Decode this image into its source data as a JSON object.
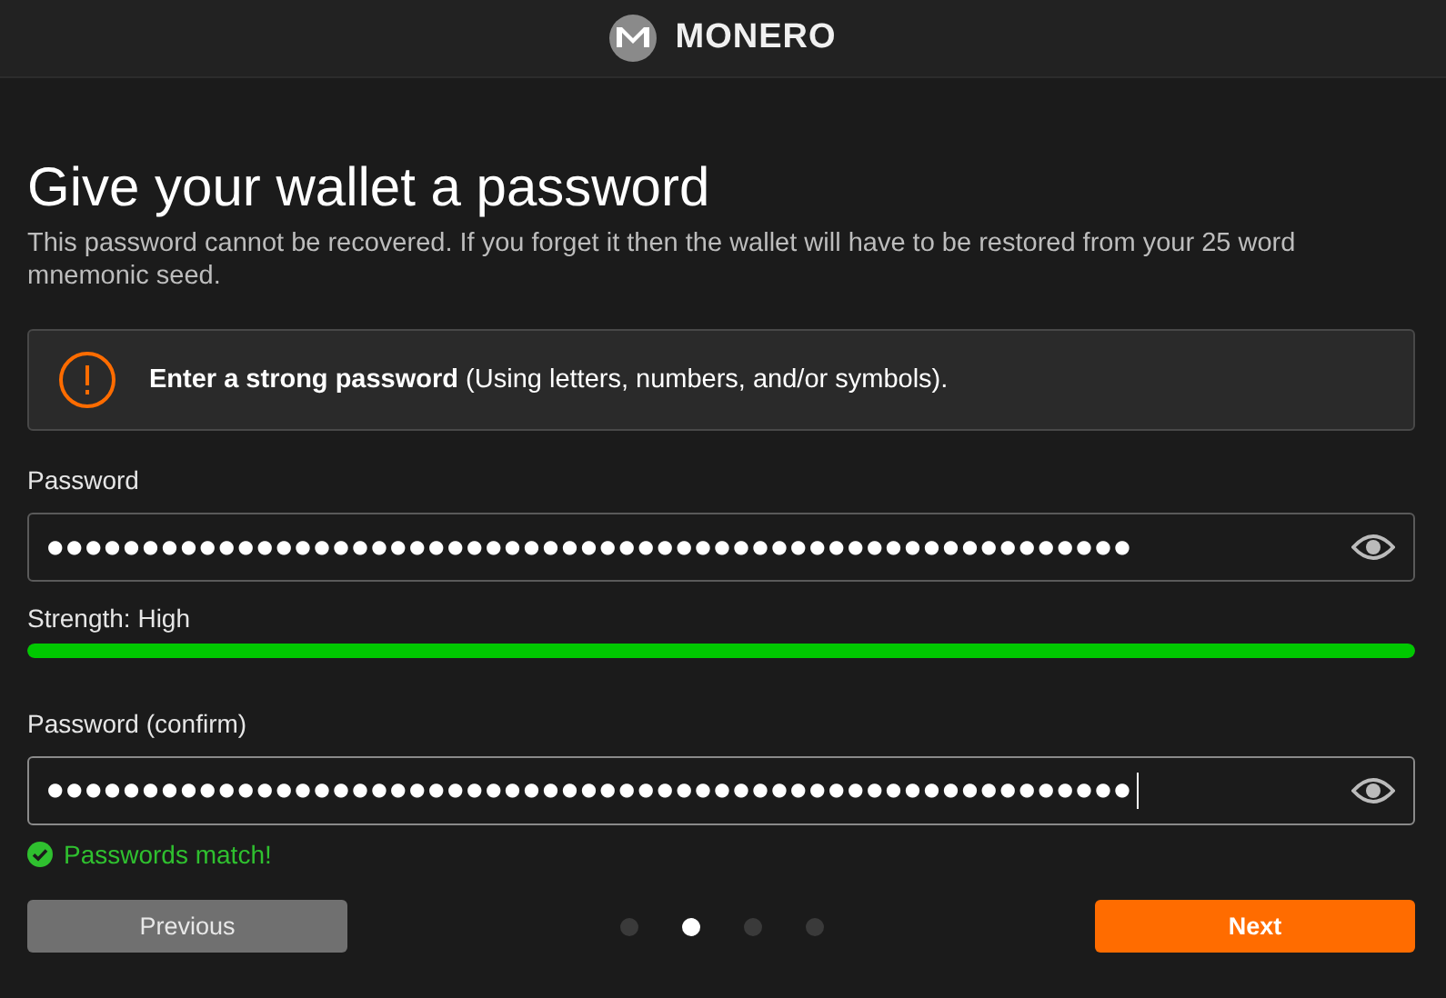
{
  "header": {
    "brand": "MONERO"
  },
  "title": "Give your wallet a password",
  "subtitle": "This password cannot be recovered. If you forget it then the wallet will have to be restored from your 25 word mnemonic seed.",
  "notice": {
    "kind": "warning",
    "text": "**Enter a strong password** (Using letters, numbers, and/or symbols)."
  },
  "password": {
    "label": "Password",
    "value": "●●●●●●●●●●●●●●●●●●●●●●●●●●●●●●●●●●●●●●●●●●●●●●●●●●●●●●●●●"
  },
  "strength": {
    "label": "Strength: High",
    "level": 1
  },
  "confirm": {
    "label": "Password (confirm)",
    "value": "●●●●●●●●●●●●●●●●●●●●●●●●●●●●●●●●●●●●●●●●●●●●●●●●●●●●●●●●●",
    "focused": true
  },
  "match": {
    "matched": true,
    "text": "Passwords match!"
  },
  "steps": [
    {
      "selected": false
    },
    {
      "selected": true
    },
    {
      "selected": false
    },
    {
      "selected": false
    }
  ],
  "buttons": {
    "previous": "Previous",
    "next": "Next"
  }
}
